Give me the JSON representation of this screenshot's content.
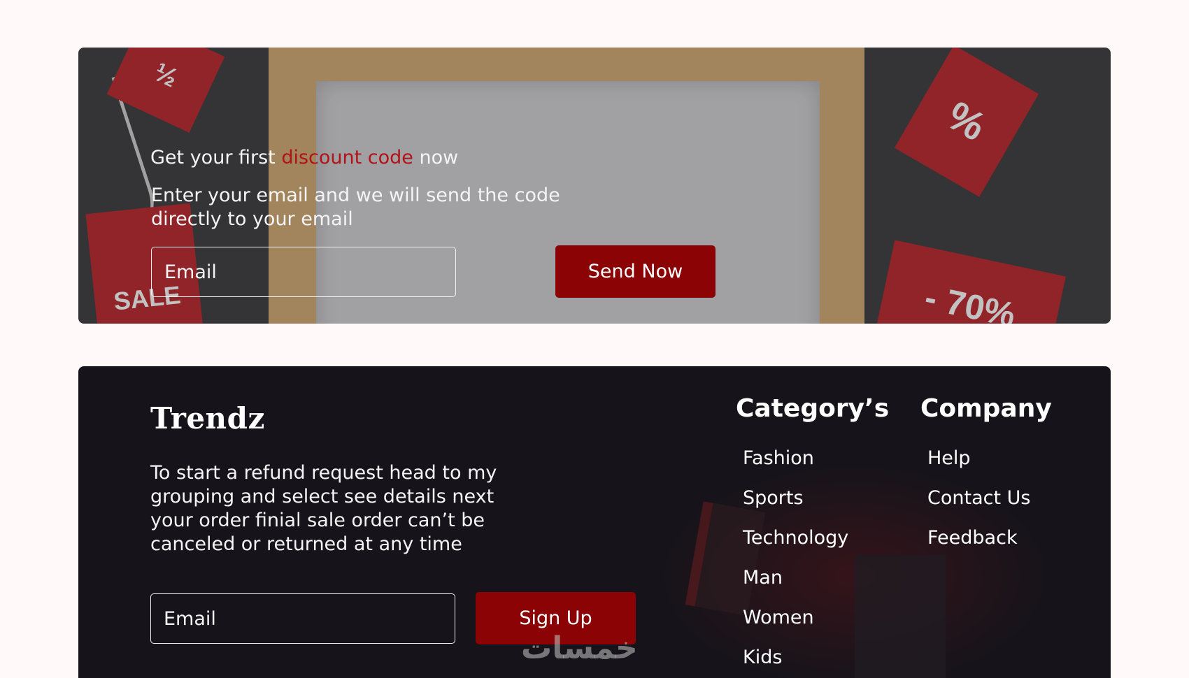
{
  "promo": {
    "line_before": "Get your first ",
    "line_highlight": "discount code",
    "line_after": " now",
    "description": "Enter your email and we will send the code directly to your email",
    "email_placeholder": "Email",
    "send_button": "Send Now",
    "tag_1": "½",
    "tag_2": "SALE",
    "tag_3": "%",
    "tag_4": "- 70%"
  },
  "footer": {
    "logo": "Trendz",
    "description": "To start a refund request head to my grouping and select see details next your order finial sale order can’t be canceled or returned at any time",
    "email_placeholder": "Email",
    "signup_button": "Sign Up",
    "categories": {
      "title": "Category’s",
      "items": [
        "Fashion",
        "Sports",
        "Technology",
        "Man",
        "Women",
        "Kids"
      ]
    },
    "company": {
      "title": "Company",
      "items": [
        "Help",
        "Contact Us",
        "Feedback"
      ]
    }
  },
  "watermark": "خمسات",
  "colors": {
    "page_background": "#fff9f9",
    "accent_red": "#8b0304",
    "highlight_red": "#b31217",
    "footer_background": "#16141a"
  }
}
